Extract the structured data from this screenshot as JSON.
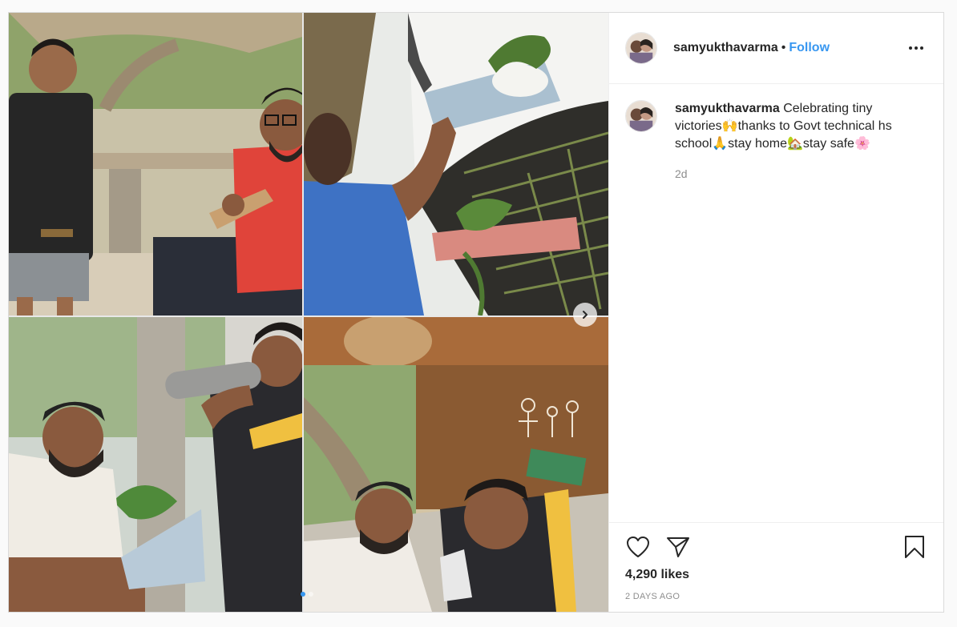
{
  "post": {
    "username": "samyukthavarma",
    "separator": "•",
    "follow_label": "Follow",
    "more_icon": "more-options-icon",
    "caption": {
      "username": "samyukthavarma",
      "text": "Celebrating tiny victories🙌thanks to Govt technical hs school🙏stay home🏡stay safe🌸",
      "time_ago": "2d"
    },
    "likes": "4,290 likes",
    "date": "2 DAYS AGO"
  },
  "carousel": {
    "next_icon": "chevron-right-icon",
    "dots_total": 2,
    "active_index": 0
  },
  "icons": {
    "like": "heart-icon",
    "share": "paper-plane-icon",
    "save": "bookmark-icon"
  },
  "colors": {
    "accent": "#3897f0",
    "text": "#262626",
    "muted": "#8e8e8e",
    "border": "#dbdbdb"
  }
}
